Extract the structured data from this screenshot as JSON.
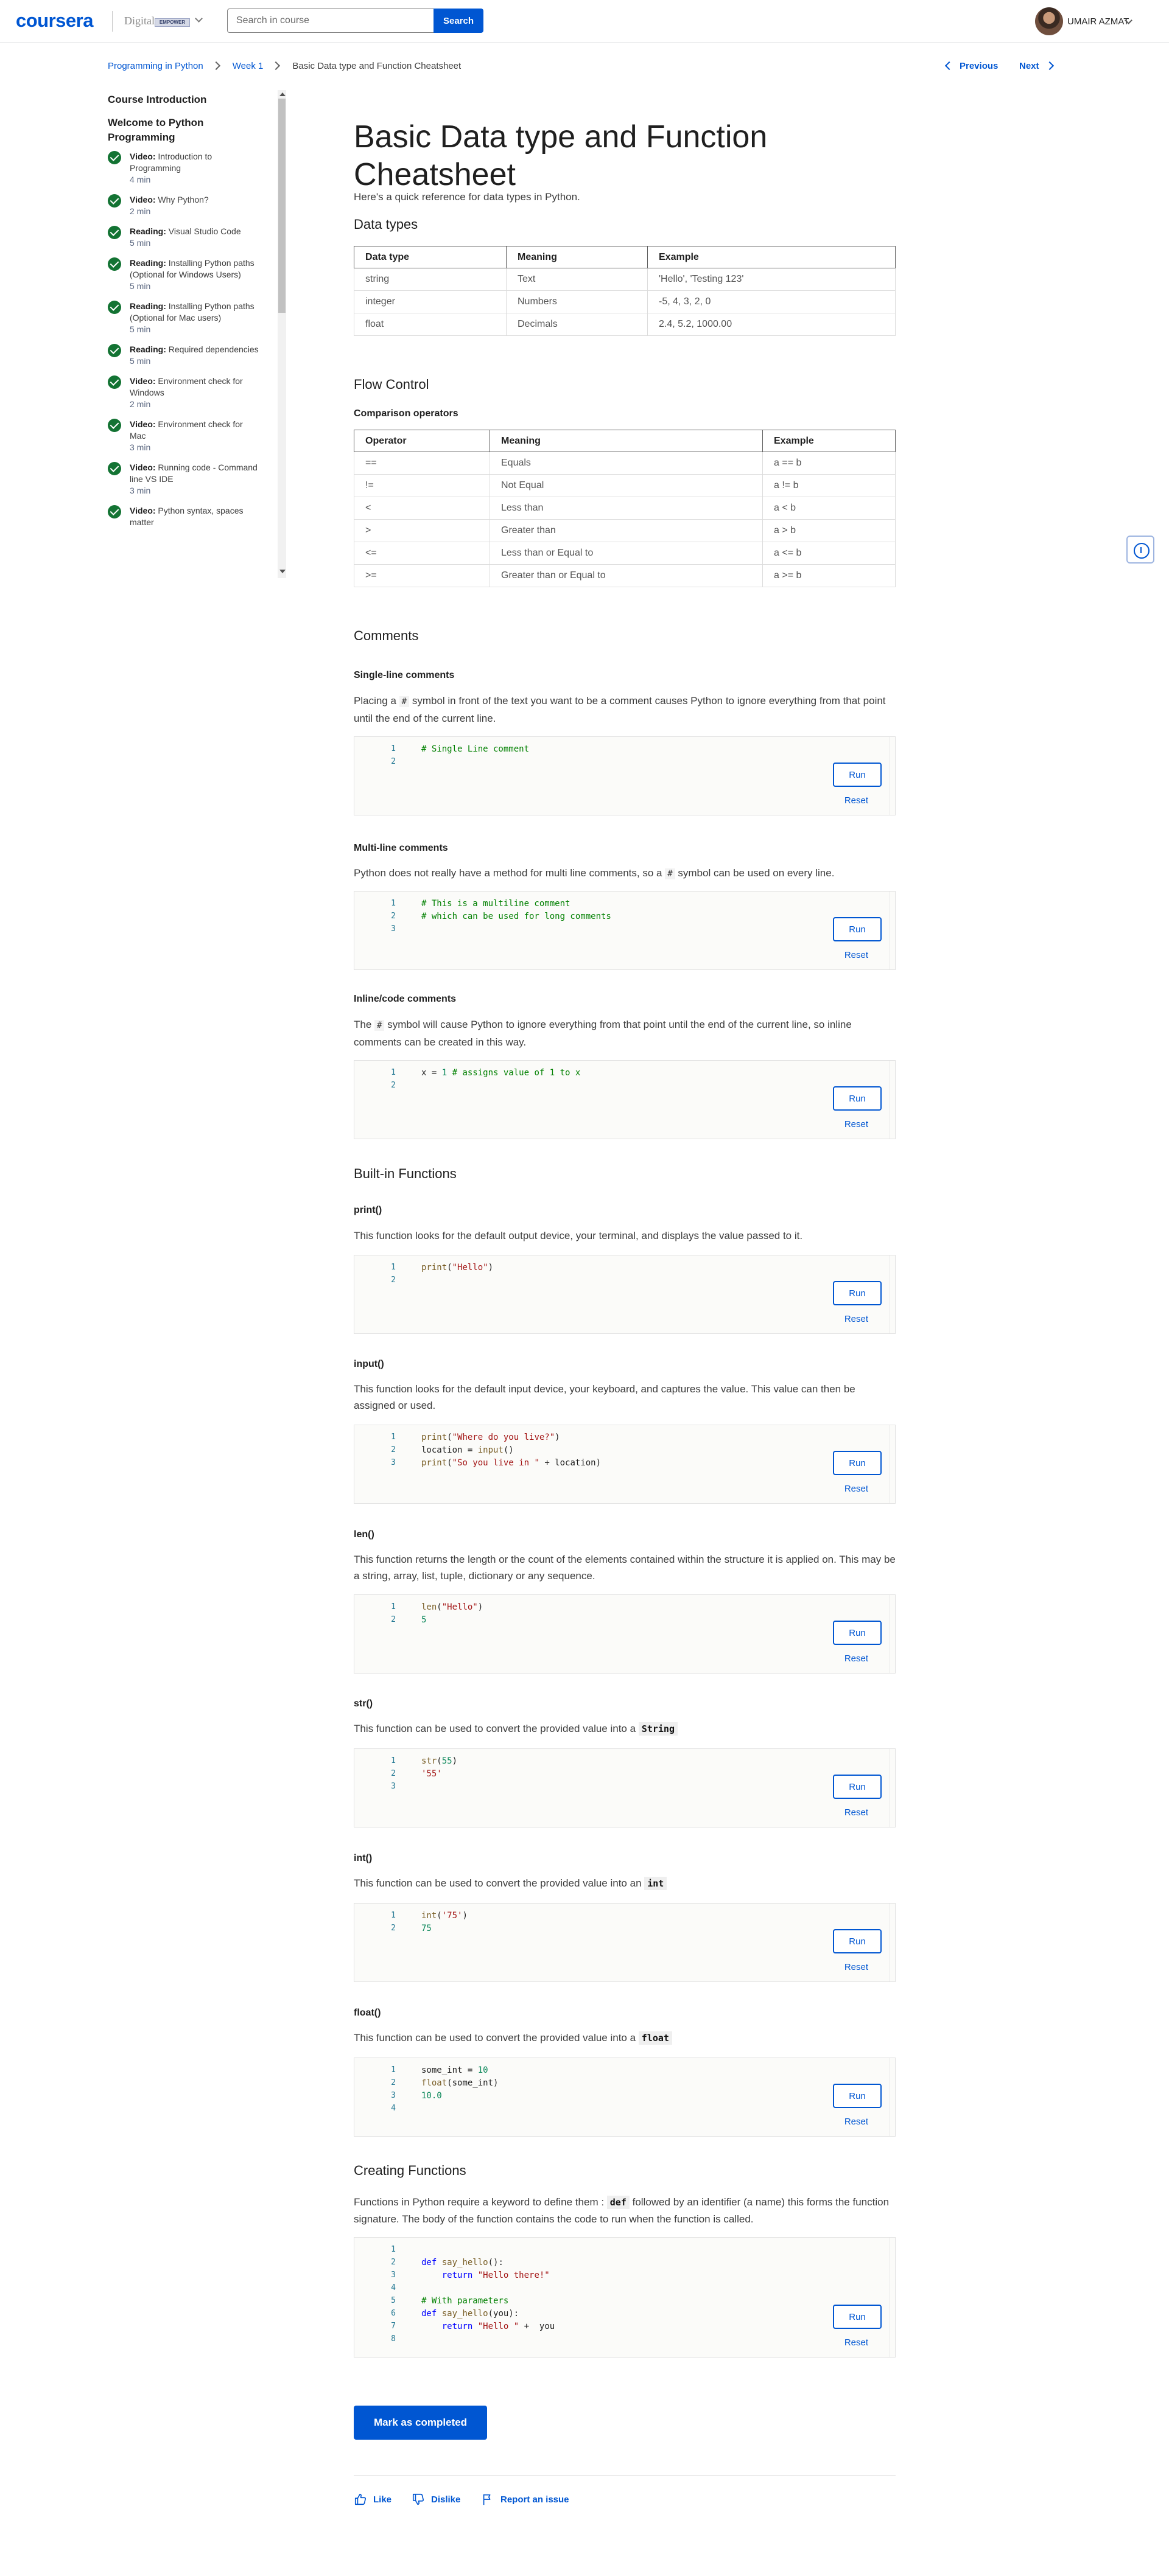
{
  "header": {
    "logo": "coursera",
    "partner_text": "Digital",
    "partner_badge": "EMPOWER",
    "search_placeholder": "Search in course",
    "search_button": "Search",
    "user_name": "UMAIR AZMAT"
  },
  "breadcrumb": {
    "items": [
      "Programming in Python",
      "Week 1"
    ],
    "current": "Basic Data type and Function Cheatsheet"
  },
  "nav": {
    "previous": "Previous",
    "next": "Next"
  },
  "sidebar": {
    "title": "Course Introduction",
    "module": "Welcome to Python Programming",
    "items": [
      {
        "type": "Video:",
        "label": "Introduction to Programming",
        "duration": "4 min"
      },
      {
        "type": "Video:",
        "label": "Why Python?",
        "duration": "2 min"
      },
      {
        "type": "Reading:",
        "label": "Visual Studio Code",
        "duration": "5 min"
      },
      {
        "type": "Reading:",
        "label": "Installing Python paths (Optional for Windows Users)",
        "duration": "5 min"
      },
      {
        "type": "Reading:",
        "label": "Installing Python paths (Optional for Mac users)",
        "duration": "5 min"
      },
      {
        "type": "Reading:",
        "label": "Required dependencies",
        "duration": "5 min"
      },
      {
        "type": "Video:",
        "label": "Environment check for Windows",
        "duration": "2 min"
      },
      {
        "type": "Video:",
        "label": "Environment check for Mac",
        "duration": "3 min"
      },
      {
        "type": "Video:",
        "label": "Running code - Command line VS IDE",
        "duration": "3 min"
      },
      {
        "type": "Video:",
        "label": "Python syntax, spaces matter",
        "duration": ""
      }
    ]
  },
  "main": {
    "title": "Basic Data type and Function Cheatsheet",
    "intro": "Here's a quick reference for data types in Python.",
    "data_types": {
      "heading": "Data types",
      "headers": [
        "Data type",
        "Meaning",
        "Example"
      ],
      "rows": [
        [
          "string",
          "Text",
          "'Hello', 'Testing 123'"
        ],
        [
          "integer",
          "Numbers",
          "-5, 4, 3, 2, 0"
        ],
        [
          "float",
          "Decimals",
          "2.4, 5.2, 1000.00"
        ]
      ]
    },
    "flow_control": {
      "heading": "Flow Control",
      "subheading": "Comparison operators",
      "headers": [
        "Operator",
        "Meaning",
        "Example"
      ],
      "rows": [
        [
          "==",
          "Equals",
          "a == b"
        ],
        [
          "!=",
          "Not Equal",
          "a != b"
        ],
        [
          "<",
          "Less than",
          "a < b"
        ],
        [
          ">",
          "Greater than",
          "a > b"
        ],
        [
          "<=",
          "Less than or Equal to",
          "a <= b"
        ],
        [
          ">=",
          "Greater than or Equal to",
          "a >= b"
        ]
      ]
    },
    "comments": {
      "heading": "Comments",
      "single": {
        "title": "Single-line comments",
        "text_before": "Placing a ",
        "symbol": "#",
        "text_after": " symbol in front of the text you want to be a comment causes Python to ignore everything from that point until the end of the current line.",
        "lines": [
          "# Single Line comment",
          ""
        ]
      },
      "multi": {
        "title": "Multi-line comments",
        "text_before": "Python does not really have a method for multi line comments, so a ",
        "symbol": "#",
        "text_after": " symbol can be used on every line.",
        "lines": [
          "# This is a multiline comment",
          "# which can be used for long comments",
          ""
        ]
      },
      "inline": {
        "title": "Inline/code comments",
        "text_before": "The ",
        "symbol": "#",
        "text_after": " symbol will cause Python to ignore everything from that point until the end of the current line, so inline comments can be created in this way.",
        "lines": [
          "x = 1 # assigns value of 1 to x",
          ""
        ]
      }
    },
    "builtins": {
      "heading": "Built-in Functions",
      "print": {
        "title": "print()",
        "text": "This function looks for the default output device, your terminal, and displays the value passed to it.",
        "lines": [
          "print(\"Hello\")",
          ""
        ]
      },
      "input": {
        "title": "input()",
        "text": "This function looks for the default input device, your keyboard, and captures the value. This value can then be assigned or used.",
        "lines": [
          "print(\"Where do you live?\")",
          "location = input()",
          "print(\"So you live in \" + location)"
        ]
      },
      "len": {
        "title": "len()",
        "text": "This function returns the length or the count of the elements contained within the structure it is applied on. This may be a string, array, list, tuple, dictionary or any sequence.",
        "lines": [
          "len(\"Hello\")",
          "5"
        ]
      },
      "str": {
        "title": "str()",
        "text": "This function can be used to convert the provided value into a ",
        "keyword": "String",
        "lines": [
          "str(55)",
          "'55'",
          ""
        ]
      },
      "int": {
        "title": "int()",
        "text": "This function can be used to convert the provided value into an ",
        "keyword": "int",
        "lines": [
          "int('75')",
          "75"
        ]
      },
      "float": {
        "title": "float()",
        "text": "This function can be used to convert the provided value into a ",
        "keyword": "float",
        "lines": [
          "some_int = 10",
          "float(some_int)",
          "10.0",
          ""
        ]
      }
    },
    "creating_functions": {
      "heading": "Creating Functions",
      "text_before": "Functions in Python require a keyword to define them : ",
      "keyword": "def",
      "text_after": "  followed by an identifier (a name) this forms the function signature. The body of the function contains the code to run when the function is called.",
      "lines": [
        "",
        "def say_hello():",
        "    return \"Hello there!\"",
        "",
        "# With parameters",
        "def say_hello(you):",
        "    return \"Hello \" +  you",
        ""
      ]
    },
    "run_label": "Run",
    "reset_label": "Reset",
    "mark_completed": "Mark as completed",
    "feedback": {
      "like": "Like",
      "dislike": "Dislike",
      "report": "Report an issue"
    }
  }
}
